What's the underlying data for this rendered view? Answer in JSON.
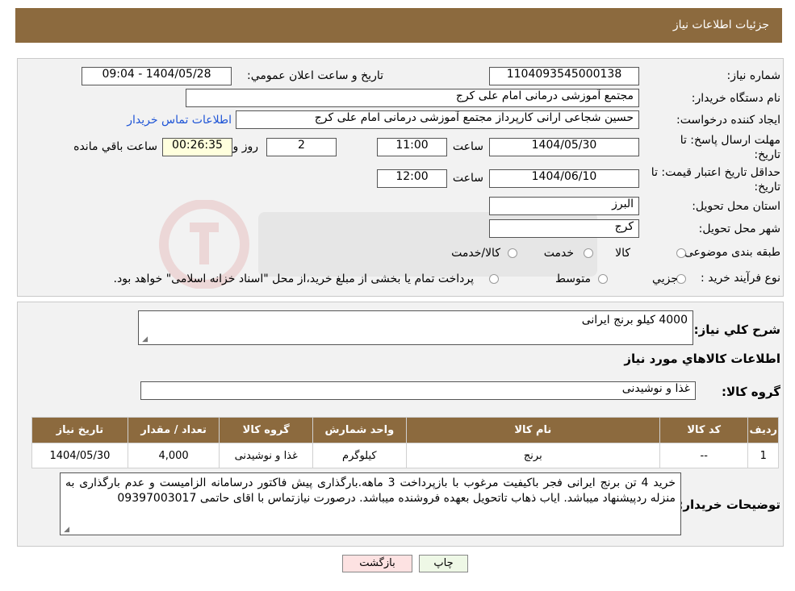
{
  "header": {
    "title": "جزئیات اطلاعات نیاز"
  },
  "form": {
    "need_number_label": "شماره نیاز:",
    "need_number": "1104093545000138",
    "announce_label": "تاریخ و ساعت اعلان عمومي:",
    "announce_value": "1404/05/28 - 09:04",
    "buyer_org_label": "نام دستگاه خریدار:",
    "buyer_org": "مجتمع آموزشی درمانی امام علی کرج",
    "requester_label": "ایجاد کننده درخواست:",
    "requester": "حسین شجاعی ارانی کارپرداز مجتمع آموزشی درمانی امام علی کرج",
    "contact_link": "اطلاعات تماس خریدار",
    "deadline_label_1": "مهلت ارسال پاسخ: تا",
    "deadline_label_2": "تاریخ:",
    "deadline_date": "1404/05/30",
    "time_label": "ساعت",
    "deadline_time": "11:00",
    "days_value": "2",
    "days_label": "روز و",
    "remaining_time": "00:26:35",
    "remaining_label": "ساعت باقي مانده",
    "validity_label_1": "حداقل تاریخ اعتبار قیمت: تا",
    "validity_label_2": "تاریخ:",
    "validity_date": "1404/06/10",
    "validity_time": "12:00",
    "province_label": "استان محل تحویل:",
    "province": "البرز",
    "city_label": "شهر محل تحویل:",
    "city": "کرج",
    "category_label": "طبقه بندی موضوعی:",
    "category_options": [
      "کالا",
      "خدمت",
      "کالا/خدمت"
    ],
    "process_label": "نوع فرآیند خرید :",
    "process_options": [
      "جزيي",
      "متوسط"
    ],
    "process_note": "پرداخت تمام یا بخشی از مبلغ خرید،از محل \"اسناد خزانه اسلامی\" خواهد بود."
  },
  "details": {
    "summary_label": "شرح كلي نياز:",
    "summary": "4000 کیلو برنج ایرانی",
    "goods_info_title": "اطلاعات کالاهاي مورد نياز",
    "goods_group_label": "گروه کالا:",
    "goods_group": "غذا و نوشیدنی",
    "table": {
      "headers": [
        "رديف",
        "کد کالا",
        "نام کالا",
        "واحد شمارش",
        "گروه کالا",
        "تعداد / مقدار",
        "تاریخ نیاز"
      ],
      "rows": [
        [
          "1",
          "--",
          "برنج",
          "کیلوگرم",
          "غذا و نوشیدنی",
          "4,000",
          "1404/05/30"
        ]
      ]
    },
    "buyer_notes_label": "توضیحات خریدار:",
    "buyer_notes": "خرید 4 تن برنج ایرانی فجر باکیفیت مرغوب با بازپرداخت 3 ماهه.بارگذاری پیش فاکتور درسامانه الزامیست و عدم بارگذاری به منزله ردپیشنهاد میباشد. ایاب ذهاب تاتحویل بعهده فروشنده میباشد. درصورت نیازتماس با اقای حاتمی 09397003017"
  },
  "buttons": {
    "print": "چاپ",
    "back": "بازگشت"
  },
  "colors": {
    "header_bg": "#8c6a3e",
    "link": "#1f55d6",
    "back_bg": "#fde2e2",
    "print_bg": "#eef8e6"
  }
}
